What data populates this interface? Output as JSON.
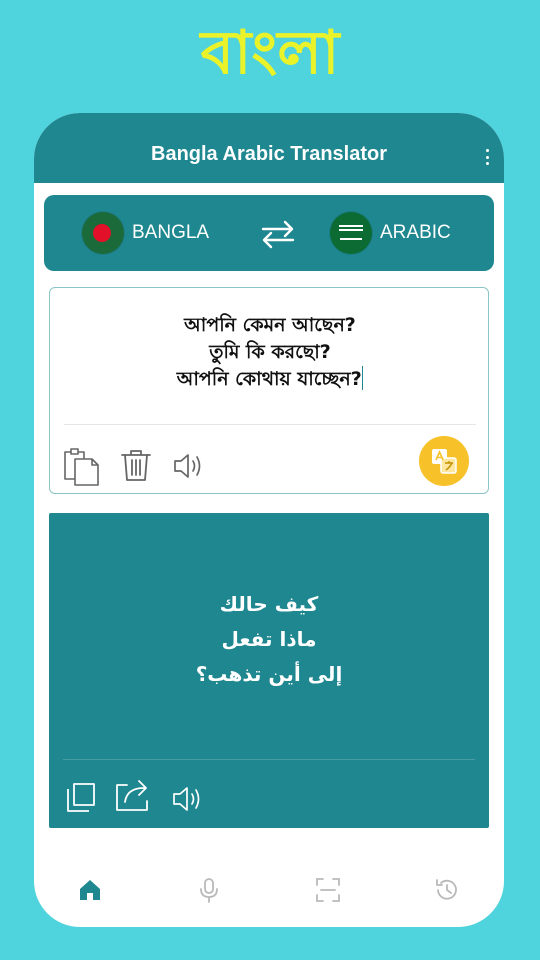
{
  "promo": {
    "title": "বাংলা"
  },
  "app_bar": {
    "title": "Bangla Arabic Translator",
    "menu_icon": "more-vert-icon"
  },
  "languages": {
    "source": {
      "label": "BANGLA",
      "flag": "bangladesh-flag"
    },
    "target": {
      "label": "ARABIC",
      "flag": "saudi-arabia-flag"
    },
    "swap_icon": "swap-icon"
  },
  "input": {
    "lines": [
      "আপনি কেমন আছেন?",
      "তুমি কি করছো?",
      "আপনি কোথায় যাচ্ছেন?"
    ],
    "tools": [
      "paste-icon",
      "delete-icon",
      "speaker-icon"
    ],
    "translate_icon": "translate-icon"
  },
  "output": {
    "lines": [
      "كيف حالك",
      "ماذا تفعل",
      "إلى أين تذهب؟"
    ],
    "tools": [
      "copy-icon",
      "share-icon",
      "speaker-icon"
    ]
  },
  "bottom_nav": [
    "home-icon",
    "microphone-icon",
    "scan-icon",
    "history-icon"
  ],
  "colors": {
    "background": "#4fd3dc",
    "primary": "#1f8790",
    "accent": "#f7c229",
    "promo_text": "#eaf22a"
  }
}
